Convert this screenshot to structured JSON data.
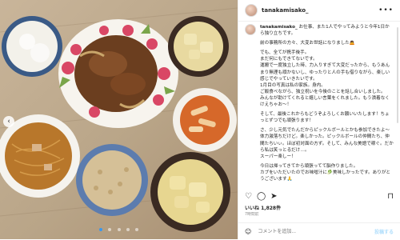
{
  "post": {
    "username": "tanakamisako_",
    "caption_username": "tanakamisako_",
    "caption_paragraphs": [
      "お仕事、また1人でやってみようと今年1日から独り立ちです。",
      "前の事務所の方々、大変お世話になりました🙇",
      "でも、全てが携手後手。\nまだ何にもできてないです。\n運搬で一度独立した時、力入りすぎて大変だったから、もうあんまり無理も頑かないし、ゆったりと人の手も借りながら、楽しい感じでやっていきたいです。\n1月目の写真は私の家族。身内。\nご飯食べながら、独立祝いを今後のことを話し合いしました。\nみんなが助けてくれると嬉しい言葉をくれました。もう漬着なくけえちゃお～！",
      "そして、最後これからもどうぞよろしくお願いいたします！ちょっとずつでも頑張ります！",
      "さ、少し元気でたんだからピックルボールとかも参加できたよ～ 体力激落ちだけど。楽しかった。ピックルボールの仲間たち、仲間たちいぃ。ほぼ初対面の方ず。そして、みんな美語で稼ぐ。だから私は笑っとるだけ…。\nスーパー楽しー！",
      "今日は帰ってきてから頑張ってて脳作りました。\nカブをいただいたのでお味噌汁に🥬美味しかったです。ありがとうございます🙏"
    ],
    "likes_label": "いいね",
    "likes_count": "1,828件",
    "date": "7時間前",
    "comment_placeholder": "コメントを追加...",
    "post_button": "投稿する",
    "more_label": "•••"
  },
  "icons": {
    "heart": "heart-icon",
    "comment": "comment-icon",
    "share": "share-icon",
    "save": "bookmark-icon",
    "emoji": "emoji-icon",
    "prev": "chevron-left-icon"
  },
  "carousel": {
    "slide_count": 5,
    "active_index": 0
  },
  "colors": {
    "accent": "#3897f0",
    "text": "#262626",
    "muted": "#8e8e8e"
  }
}
